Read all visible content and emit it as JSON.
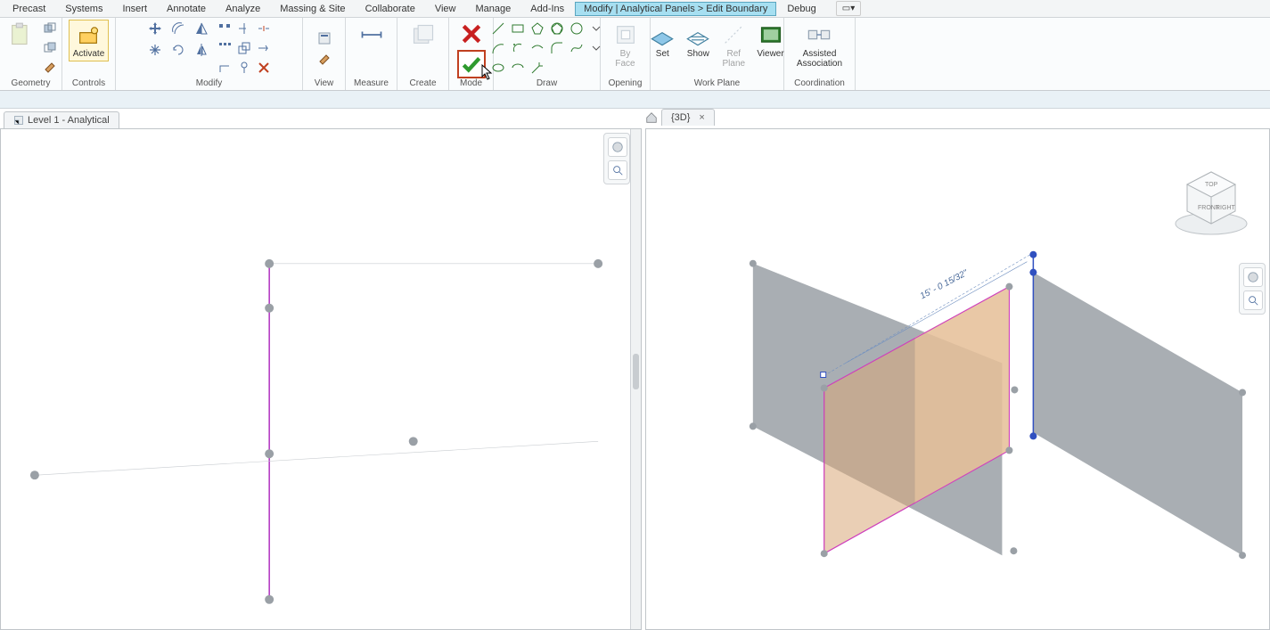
{
  "menu": {
    "items": [
      "Precast",
      "Systems",
      "Insert",
      "Annotate",
      "Analyze",
      "Massing & Site",
      "Collaborate",
      "View",
      "Manage",
      "Add-Ins",
      "Modify | Analytical Panels > Edit Boundary",
      "Debug"
    ],
    "active_index": 10,
    "extra": "▭▾"
  },
  "ribbon": {
    "geometry": {
      "label": "Geometry",
      "copy": "Copy",
      "cut": "Cut"
    },
    "controls": {
      "label": "Controls",
      "activate": "Activate",
      "activate_sub": ""
    },
    "modify": {
      "label": "Modify"
    },
    "view": {
      "label": "View"
    },
    "measure": {
      "label": "Measure"
    },
    "create": {
      "label": "Create"
    },
    "mode": {
      "label": "Mode"
    },
    "draw": {
      "label": "Draw"
    },
    "opening": {
      "label": "Opening",
      "byface": "By\nFace"
    },
    "workplane": {
      "label": "Work Plane",
      "set": "Set",
      "show": "Show",
      "ref": "Ref\nPlane",
      "viewer": "Viewer"
    },
    "coordination": {
      "label": "Coordination",
      "assoc": "Assisted\nAssociation"
    }
  },
  "tabs": {
    "left": {
      "label": "Level 1 - Analytical"
    },
    "right": {
      "label": "{3D}"
    }
  },
  "viewcube": {
    "front": "FRONT",
    "right": "RIGHT",
    "top": "TOP"
  },
  "dimension": {
    "value": "15' - 0 15/32\""
  }
}
